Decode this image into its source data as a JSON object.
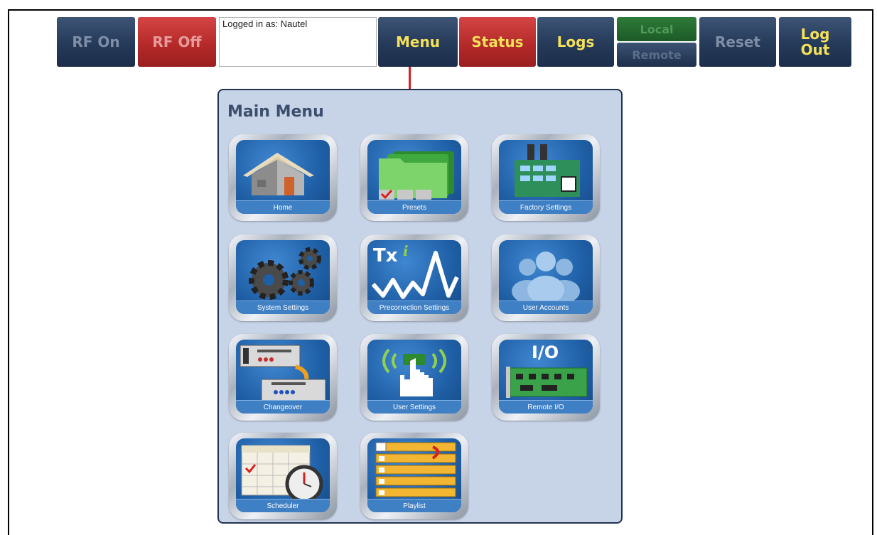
{
  "toolbar": {
    "rf_on": "RF On",
    "rf_off": "RF Off",
    "logged_in": "Logged in as: Nautel",
    "menu": "Menu",
    "status": "Status",
    "logs": "Logs",
    "local": "Local",
    "remote": "Remote",
    "reset": "Reset",
    "logout_line1": "Log",
    "logout_line2": "Out"
  },
  "menu": {
    "title": "Main Menu",
    "items": [
      {
        "label": "Home",
        "icon": "house-icon"
      },
      {
        "label": "Presets",
        "icon": "folders-icon"
      },
      {
        "label": "Factory Settings",
        "icon": "factory-icon"
      },
      {
        "label": "System Settings",
        "icon": "gears-icon"
      },
      {
        "label": "Precorrection Settings",
        "icon": "txi-waveform-icon"
      },
      {
        "label": "User Accounts",
        "icon": "users-icon"
      },
      {
        "label": "Changeover",
        "icon": "changeover-icon"
      },
      {
        "label": "User Settings",
        "icon": "touch-hand-icon"
      },
      {
        "label": "Remote I/O",
        "icon": "circuit-board-icon"
      },
      {
        "label": "Scheduler",
        "icon": "calendar-clock-icon"
      },
      {
        "label": "Playlist",
        "icon": "playlist-icon"
      }
    ]
  },
  "colors": {
    "navy": "#253a59",
    "red": "#b52a2a",
    "yellow_text": "#f6e15a",
    "panel_bg": "#c7d3e6",
    "arrow": "#e01e1e"
  }
}
